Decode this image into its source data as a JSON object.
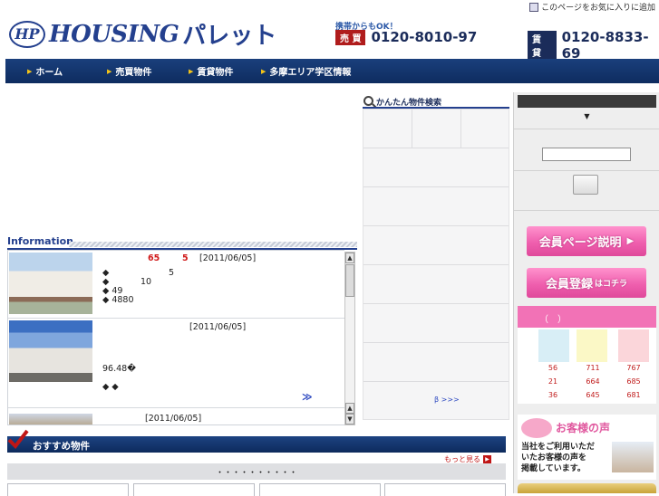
{
  "topbar": {
    "favorite_label": "このページをお気に入りに追加"
  },
  "header": {
    "logo_mark": "HP",
    "logo_word": "HOUSING",
    "logo_jp": "パレット",
    "mobile_ok": "携帯からもOK！",
    "sale": {
      "tag": "売 買",
      "number": "0120-8010-97"
    },
    "rent": {
      "tag": "賃 貸",
      "number": "0120-8833-69"
    }
  },
  "nav": {
    "items": [
      {
        "label": "ホーム"
      },
      {
        "label": "売買物件"
      },
      {
        "label": "賃貸物件"
      },
      {
        "label": "多摩エリア学区情報"
      }
    ]
  },
  "information": {
    "title": "Information",
    "entries": [
      {
        "red_a": "65",
        "red_b": "5",
        "date": "[2011/06/05]",
        "lines": [
          "◆",
          "◆",
          "◆ 49",
          "◆ 4880"
        ],
        "num_a": "5",
        "num_b": "10"
      },
      {
        "date": "[2011/06/05]",
        "area": "96.48�",
        "marks": "◆ ◆",
        "more": "≫"
      },
      {
        "date": "[2011/06/05]"
      }
    ]
  },
  "recommended": {
    "title": "おすすめ物件",
    "more_label": "もっと見る",
    "bar_label": "・・・・・・・・・・"
  },
  "search": {
    "title": "かんたん物件検索",
    "link": "β >>>"
  },
  "side": {
    "dropdown_arrow": "▼",
    "member_page_btn": "会員ページ説明",
    "member_reg_btn": "会員登録",
    "member_reg_small": "はコチラ",
    "pink_bar": "（　）",
    "stats": {
      "colors": [
        "#d8eef6",
        "#fbf8c6",
        "#fbd6da"
      ],
      "rows": [
        [
          "56",
          "711",
          "767"
        ],
        [
          "21",
          "664",
          "685"
        ],
        [
          "36",
          "645",
          "681"
        ]
      ]
    },
    "voice": {
      "title": "お客様の声",
      "lines": [
        "当社をご利用いただ",
        "いたお客様の声を",
        "掲載しています。"
      ]
    }
  }
}
